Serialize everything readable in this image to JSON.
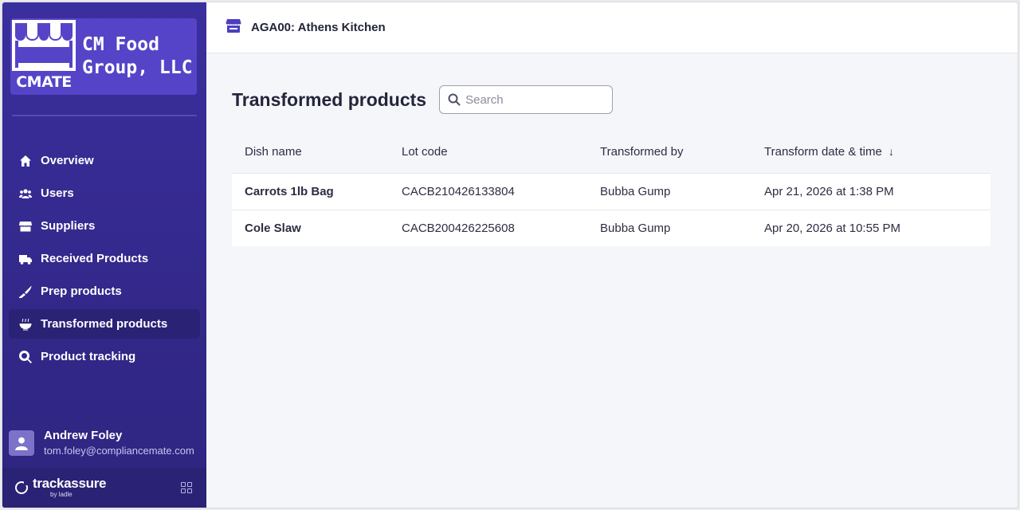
{
  "logo": {
    "mark_text": "CMATE",
    "company_line1": "CM Food",
    "company_line2": "Group, LLC"
  },
  "sidebar": {
    "items": [
      {
        "label": "Overview",
        "icon": "home-icon"
      },
      {
        "label": "Users",
        "icon": "users-icon"
      },
      {
        "label": "Suppliers",
        "icon": "store-icon"
      },
      {
        "label": "Received Products",
        "icon": "truck-icon"
      },
      {
        "label": "Prep products",
        "icon": "knife-icon"
      },
      {
        "label": "Transformed products",
        "icon": "bowl-icon",
        "active": true
      },
      {
        "label": "Product tracking",
        "icon": "search-icon"
      }
    ]
  },
  "user": {
    "name": "Andrew Foley",
    "email": "tom.foley@compliancemate.com"
  },
  "footer": {
    "brand": "trackassure",
    "by": "by ladle"
  },
  "header": {
    "store": "AGA00: Athens Kitchen"
  },
  "main": {
    "title": "Transformed products",
    "search_placeholder": "Search",
    "columns": [
      "Dish name",
      "Lot code",
      "Transformed by",
      "Transform date & time"
    ],
    "sort_indicator": "↓",
    "rows": [
      {
        "dish": "Carrots 1lb Bag",
        "lot": "CACB210426133804",
        "by": "Bubba Gump",
        "date": "Apr 21, 2026 at 1:38 PM"
      },
      {
        "dish": "Cole Slaw",
        "lot": "CACB200426225608",
        "by": "Bubba Gump",
        "date": "Apr 20, 2026 at 10:55 PM"
      }
    ]
  },
  "colors": {
    "sidebar": "#3a2f9e",
    "accent": "#5544c8",
    "active": "#2a2275"
  }
}
